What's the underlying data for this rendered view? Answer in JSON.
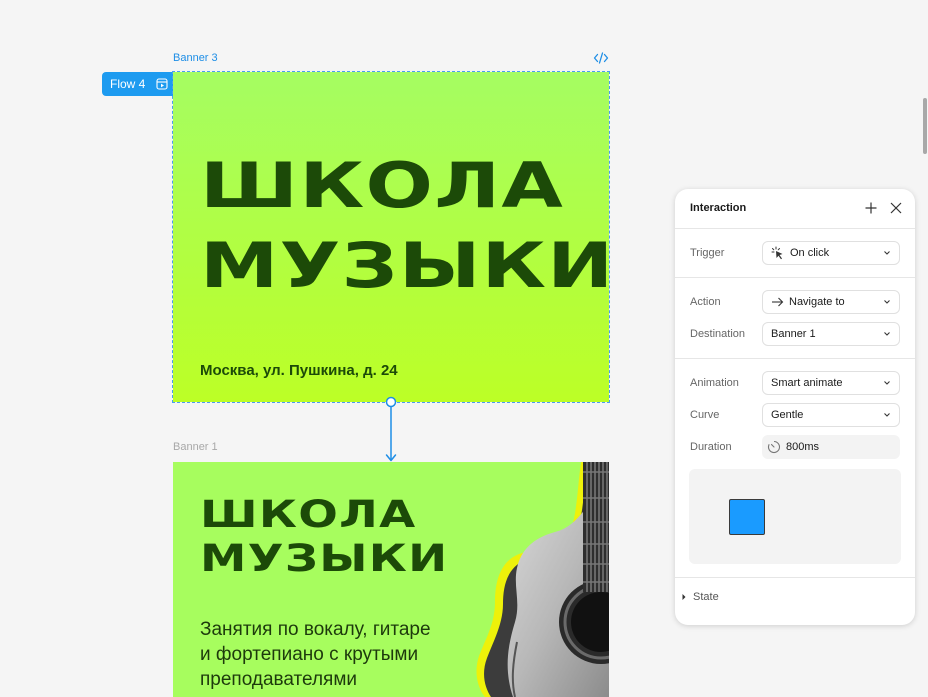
{
  "canvas": {
    "banner3": {
      "label": "Banner 3",
      "title_line1": "ШКОЛА",
      "title_line2": "МУЗЫКИ",
      "address": "Москва, ул. Пушкина, д. 24"
    },
    "flow_tag": {
      "label": "Flow 4"
    },
    "banner1": {
      "label": "Banner 1",
      "title_line1": "ШКОЛА",
      "title_line2": "МУЗЫКИ",
      "description_line1": "Занятия по вокалу, гитаре",
      "description_line2": "и фортепиано с крутыми",
      "description_line3": "преподавателями"
    }
  },
  "panel": {
    "title": "Interaction",
    "trigger": {
      "label": "Trigger",
      "value": "On click"
    },
    "action": {
      "label": "Action",
      "value": "Navigate to"
    },
    "destination": {
      "label": "Destination",
      "value": "Banner 1"
    },
    "animation": {
      "label": "Animation",
      "value": "Smart animate"
    },
    "curve": {
      "label": "Curve",
      "value": "Gentle"
    },
    "duration": {
      "label": "Duration",
      "value": "800ms"
    },
    "state": {
      "label": "State"
    }
  },
  "colors": {
    "accent": "#1d9bf0",
    "banner_green": "#a7fd5e",
    "banner_lime": "#bcff26",
    "title_dark_green": "#1c4a08",
    "preview_square": "#1a9bff"
  },
  "icons": {
    "code": "code-icon",
    "flow": "flow-start-icon",
    "add": "plus-icon",
    "close": "close-icon",
    "trigger": "tap-icon",
    "action": "arrow-right-icon",
    "duration": "timer-icon",
    "dropdown": "chevron-down-icon",
    "state": "chevron-right-icon"
  }
}
